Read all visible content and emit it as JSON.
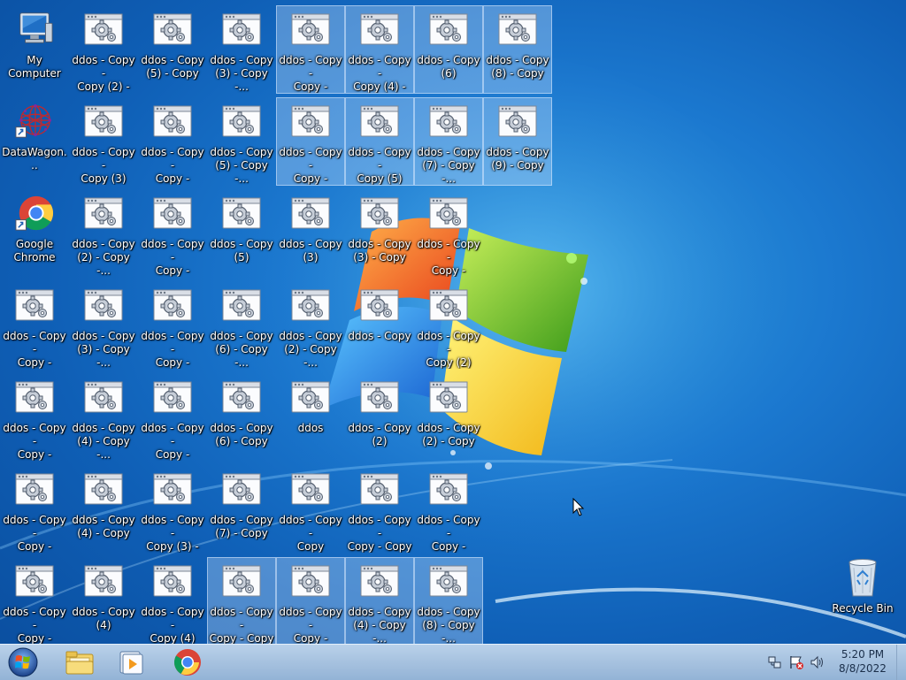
{
  "desktop": {
    "icons": [
      {
        "label": "My Computer",
        "type": "computer",
        "selected": false
      },
      {
        "label": "ddos - Copy -\nCopy (2) - C...",
        "type": "ddos",
        "selected": false
      },
      {
        "label": "ddos - Copy\n(5) - Copy",
        "type": "ddos",
        "selected": false
      },
      {
        "label": "ddos - Copy\n(3) - Copy -...",
        "type": "ddos",
        "selected": false
      },
      {
        "label": "ddos - Copy -\nCopy - Cop...",
        "type": "ddos",
        "selected": true
      },
      {
        "label": "ddos - Copy -\nCopy (4) - C...",
        "type": "ddos",
        "selected": true
      },
      {
        "label": "ddos - Copy\n(6)",
        "type": "ddos",
        "selected": true
      },
      {
        "label": "ddos - Copy\n(8) - Copy",
        "type": "ddos",
        "selected": true
      },
      {
        "label": "DataWagon...",
        "type": "datawagon",
        "selected": false
      },
      {
        "label": "ddos - Copy -\nCopy (3)",
        "type": "ddos",
        "selected": false
      },
      {
        "label": "ddos - Copy -\nCopy - Cop...",
        "type": "ddos",
        "selected": false
      },
      {
        "label": "ddos - Copy\n(5) - Copy -...",
        "type": "ddos",
        "selected": false
      },
      {
        "label": "ddos - Copy -\nCopy - Cop...",
        "type": "ddos",
        "selected": true
      },
      {
        "label": "ddos - Copy -\nCopy (5)",
        "type": "ddos",
        "selected": true
      },
      {
        "label": "ddos - Copy\n(7) - Copy -...",
        "type": "ddos",
        "selected": true
      },
      {
        "label": "ddos - Copy\n(9) - Copy",
        "type": "ddos",
        "selected": true
      },
      {
        "label": "Google\nChrome",
        "type": "chrome",
        "selected": false
      },
      {
        "label": "ddos - Copy\n(2) - Copy -...",
        "type": "ddos",
        "selected": false
      },
      {
        "label": "ddos - Copy -\nCopy - Cop...",
        "type": "ddos",
        "selected": false
      },
      {
        "label": "ddos - Copy\n(5)",
        "type": "ddos",
        "selected": false
      },
      {
        "label": "ddos - Copy\n(3)",
        "type": "ddos",
        "selected": false
      },
      {
        "label": "ddos - Copy\n(3) - Copy",
        "type": "ddos",
        "selected": false
      },
      {
        "label": "ddos - Copy -\nCopy - Cop...",
        "type": "ddos",
        "selected": false
      },
      {
        "label": "ddos - Copy -\nCopy - Cop...",
        "type": "ddos",
        "selected": false
      },
      {
        "label": "ddos - Copy\n(3) - Copy -...",
        "type": "ddos",
        "selected": false
      },
      {
        "label": "ddos - Copy -\nCopy - Cop...",
        "type": "ddos",
        "selected": false
      },
      {
        "label": "ddos - Copy\n(6) - Copy -...",
        "type": "ddos",
        "selected": false
      },
      {
        "label": "ddos - Copy\n(2) - Copy -...",
        "type": "ddos",
        "selected": false
      },
      {
        "label": "ddos - Copy",
        "type": "ddos",
        "selected": false
      },
      {
        "label": "ddos - Copy -\nCopy (2)",
        "type": "ddos",
        "selected": false
      },
      {
        "label": "ddos - Copy -\nCopy - Cop...",
        "type": "ddos",
        "selected": false
      },
      {
        "label": "ddos - Copy\n(4) - Copy -...",
        "type": "ddos",
        "selected": false
      },
      {
        "label": "ddos - Copy -\nCopy - Cop...",
        "type": "ddos",
        "selected": false
      },
      {
        "label": "ddos - Copy\n(6) - Copy",
        "type": "ddos",
        "selected": false
      },
      {
        "label": "ddos",
        "type": "ddos",
        "selected": false
      },
      {
        "label": "ddos - Copy\n(2)",
        "type": "ddos",
        "selected": false
      },
      {
        "label": "ddos - Copy\n(2) - Copy",
        "type": "ddos",
        "selected": false
      },
      {
        "label": "ddos - Copy -\nCopy - Cop...",
        "type": "ddos",
        "selected": false
      },
      {
        "label": "ddos - Copy\n(4) - Copy",
        "type": "ddos",
        "selected": false
      },
      {
        "label": "ddos - Copy -\nCopy (3) - C...",
        "type": "ddos",
        "selected": false
      },
      {
        "label": "ddos - Copy\n(7) - Copy",
        "type": "ddos",
        "selected": false
      },
      {
        "label": "ddos - Copy -\nCopy",
        "type": "ddos",
        "selected": false
      },
      {
        "label": "ddos - Copy -\nCopy - Copy",
        "type": "ddos",
        "selected": false
      },
      {
        "label": "ddos - Copy -\nCopy - Cop...",
        "type": "ddos",
        "selected": false
      },
      {
        "label": "ddos - Copy -\nCopy - Cop...",
        "type": "ddos",
        "selected": false
      },
      {
        "label": "ddos - Copy\n(4)",
        "type": "ddos",
        "selected": false
      },
      {
        "label": "ddos - Copy -\nCopy (4)",
        "type": "ddos",
        "selected": false
      },
      {
        "label": "ddos - Copy -\nCopy - Copy\n- Copy -...",
        "type": "ddos",
        "selected": true
      },
      {
        "label": "ddos - Copy -\nCopy - Cop...",
        "type": "ddos",
        "selected": true
      },
      {
        "label": "ddos - Copy\n(4) - Copy -...",
        "type": "ddos",
        "selected": true
      },
      {
        "label": "ddos - Copy\n(8) - Copy -...",
        "type": "ddos",
        "selected": true
      },
      {
        "label": "Recycle Bin",
        "type": "recycle",
        "selected": false
      }
    ]
  },
  "taskbar": {
    "start": "start-orb-icon",
    "items": [
      {
        "name": "explorer",
        "icon": "folder-icon"
      },
      {
        "name": "media-player",
        "icon": "media-player-icon"
      },
      {
        "name": "chrome",
        "icon": "chrome-icon"
      }
    ]
  },
  "tray": {
    "time": "5:20 PM",
    "date": "8/8/2022"
  }
}
